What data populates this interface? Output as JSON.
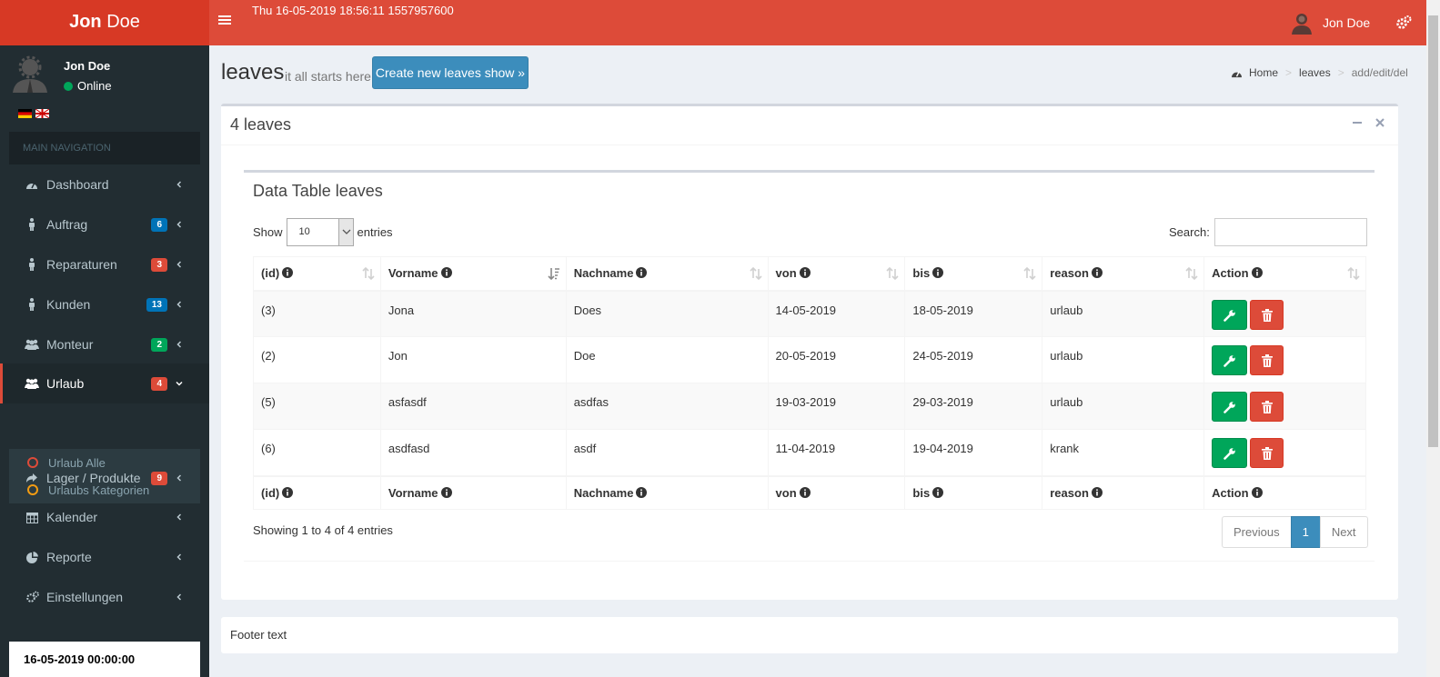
{
  "header": {
    "logo_first": "Jon",
    "logo_second": " Doe",
    "datetime": "Thu 16-05-2019 18:56:11 1557957600",
    "user_name": "Jon Doe"
  },
  "sidebar": {
    "user_name": "Jon Doe",
    "status": "Online",
    "nav_header": "MAIN NAVIGATION",
    "items": [
      {
        "label": "Dashboard",
        "icon": "tachometer-icon"
      },
      {
        "label": "Auftrag",
        "badge": "6",
        "badge_color": "#0073b7",
        "icon": "person-icon"
      },
      {
        "label": "Reparaturen",
        "badge": "3",
        "badge_color": "#dd4b39",
        "icon": "person-icon"
      },
      {
        "label": "Kunden",
        "badge": "13",
        "badge_color": "#0073b7",
        "icon": "person-icon"
      },
      {
        "label": "Monteur",
        "badge": "2",
        "badge_color": "#00a65a",
        "icon": "users-icon"
      },
      {
        "label": "Urlaub",
        "badge": "4",
        "badge_color": "#dd4b39",
        "icon": "users-icon"
      },
      {
        "label": "Lager / Produkte",
        "badge": "9",
        "badge_color": "#dd4b39",
        "icon": "share-icon"
      },
      {
        "label": "Kalender",
        "icon": "calendar-icon"
      },
      {
        "label": "Reporte",
        "icon": "pie-chart-icon"
      },
      {
        "label": "Einstellungen",
        "icon": "gears-icon"
      }
    ],
    "submenu": [
      {
        "label": "Urlaub Alle",
        "color": "#dd4b39"
      },
      {
        "label": "Urlaubs Kategorien",
        "color": "#f39c12"
      }
    ],
    "clock": "16-05-2019 00:00:00"
  },
  "content": {
    "title": "leaves",
    "subtitle": "it all starts here",
    "create_button": "Create new leaves show »",
    "breadcrumb": [
      "Home",
      "leaves",
      "add/edit/del"
    ]
  },
  "box": {
    "title": "4 leaves",
    "inner_title": "Data Table leaves",
    "show_label": "Show",
    "page_length": "10",
    "entries_label": "entries",
    "search_label": "Search:",
    "columns": [
      "(id)",
      "Vorname",
      "Nachname",
      "von",
      "bis",
      "reason",
      "Action"
    ],
    "rows": [
      [
        "(3)",
        "Jona",
        "Does",
        "14-05-2019",
        "18-05-2019",
        "urlaub"
      ],
      [
        "(2)",
        "Jon",
        "Doe",
        "20-05-2019",
        "24-05-2019",
        "urlaub"
      ],
      [
        "(5)",
        "asfasdf",
        "asdfas",
        "19-03-2019",
        "29-03-2019",
        "urlaub"
      ],
      [
        "(6)",
        "asdfasd",
        "asdf",
        "11-04-2019",
        "19-04-2019",
        "krank"
      ]
    ],
    "info": "Showing 1 to 4 of 4 entries",
    "pagination": {
      "prev": "Previous",
      "current": "1",
      "next": "Next"
    }
  },
  "footer": {
    "text": "Footer text"
  },
  "colors": {
    "header": "#dd4b39",
    "logo": "#d73925",
    "sidebar": "#222d32",
    "primary": "#3c8dbc",
    "success": "#00a65a",
    "danger": "#dd4b39"
  }
}
